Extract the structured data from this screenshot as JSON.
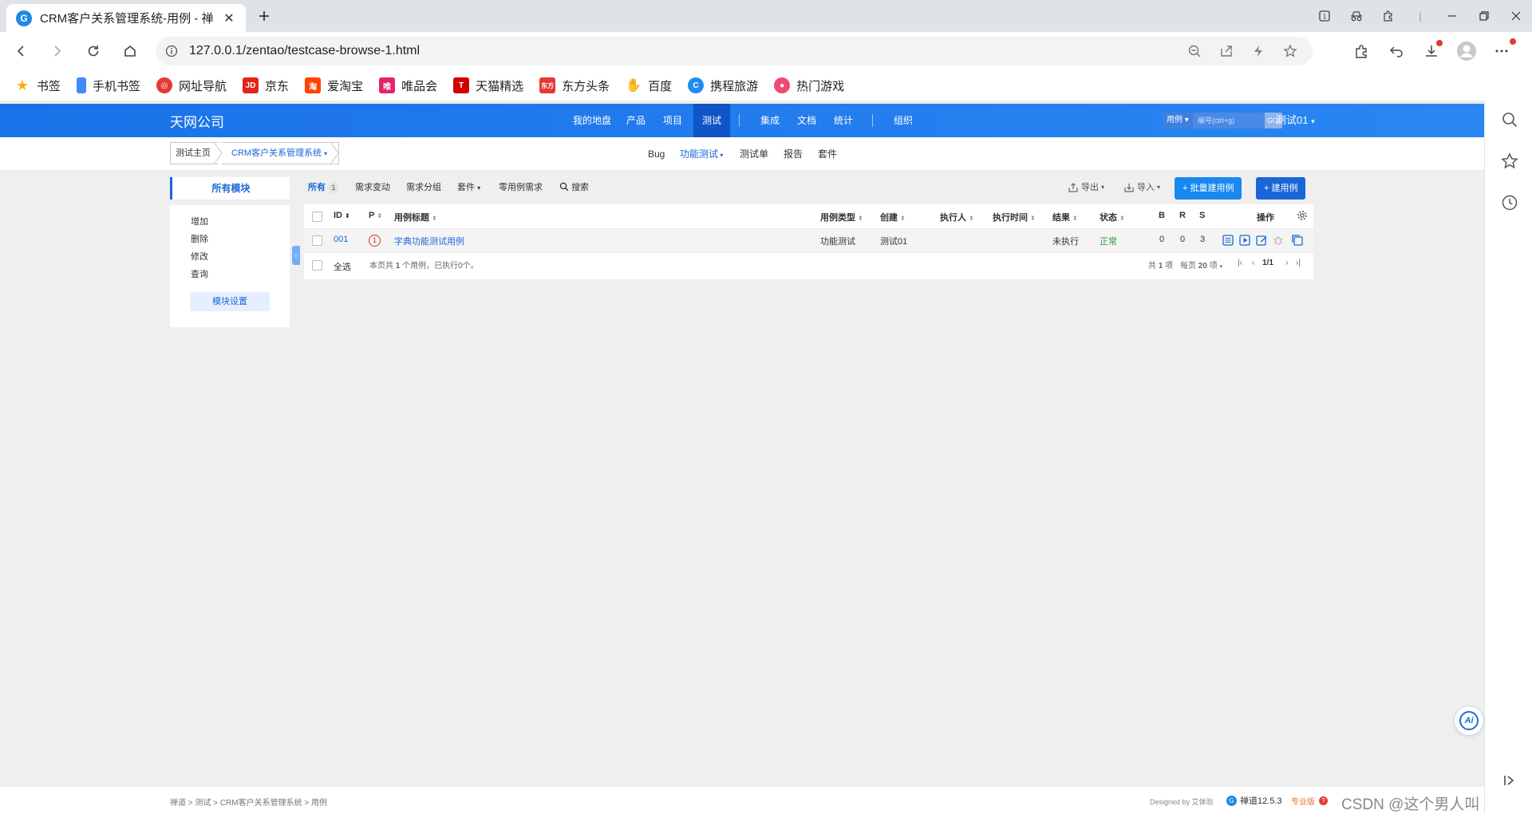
{
  "browser": {
    "tab_title": "CRM客户关系管理系统-用例 - 禅",
    "tab_favicon": "zentao-logo-icon",
    "url": "127.0.0.1/zentao/testcase-browse-1.html",
    "bookmarks": [
      {
        "label": "书签",
        "icon": "star-icon",
        "color": "#f5b400"
      },
      {
        "label": "手机书签",
        "icon": "phone-icon",
        "color": "#3d8bfd"
      },
      {
        "label": "网址导航",
        "icon": "nav-icon",
        "color": "#e53935"
      },
      {
        "label": "京东",
        "icon": "jd-icon",
        "color": "#e1251b"
      },
      {
        "label": "爱淘宝",
        "icon": "taobao-icon",
        "color": "#ff4400"
      },
      {
        "label": "唯品会",
        "icon": "vip-icon",
        "color": "#e5236d"
      },
      {
        "label": "天猫精选",
        "icon": "tmall-icon",
        "color": "#d10000"
      },
      {
        "label": "东方头条",
        "icon": "eastday-icon",
        "color": "#e53935"
      },
      {
        "label": "百度",
        "icon": "baidu-icon",
        "color": "#2932e1"
      },
      {
        "label": "携程旅游",
        "icon": "ctrip-icon",
        "color": "#1f8cf0"
      },
      {
        "label": "热门游戏",
        "icon": "game-icon",
        "color": "#ee4a77"
      }
    ]
  },
  "header": {
    "company": "天网公司",
    "nav": [
      "我的地盘",
      "产品",
      "项目",
      "测试",
      "集成",
      "文档",
      "统计",
      "组织"
    ],
    "active_nav": "测试",
    "search_type": "用例",
    "search_placeholder": "编号(ctrl+g)",
    "search_go": "GO!",
    "user": "测试01"
  },
  "subheader": {
    "crumb_home": "测试主页",
    "crumb_product": "CRM客户关系管理系统",
    "nav": [
      "Bug",
      "功能测试",
      "测试单",
      "报告",
      "套件"
    ],
    "active": "功能测试"
  },
  "modules": {
    "title": "所有模块",
    "items": [
      "增加",
      "删除",
      "修改",
      "查询"
    ],
    "setting": "模块设置"
  },
  "filters": {
    "all": "所有",
    "all_count": "1",
    "req_change": "需求变动",
    "req_group": "需求分组",
    "suite": "套件",
    "zero_case": "零用例需求",
    "search": "搜索"
  },
  "actions": {
    "export": "导出",
    "import": "导入",
    "batch_create": "+ 批量建用例",
    "create": "+ 建用例"
  },
  "table": {
    "headers": {
      "id": "ID",
      "pri": "P",
      "title": "用例标题",
      "type": "用例类型",
      "creator": "创建",
      "executor": "执行人",
      "exec_time": "执行时间",
      "result": "结果",
      "status": "状态",
      "b": "B",
      "r": "R",
      "s": "S",
      "actions": "操作"
    },
    "rows": [
      {
        "id": "001",
        "pri": "1",
        "title": "字典功能测试用例",
        "type": "功能测试",
        "creator": "测试01",
        "executor": "",
        "exec_time": "",
        "result": "未执行",
        "status": "正常",
        "b": "0",
        "r": "0",
        "s": "3"
      }
    ],
    "footer": {
      "select_all": "全选",
      "summary_prefix": "本页共",
      "summary_count": "1",
      "summary_suffix": "个用例，已执行0个。",
      "total_prefix": "共",
      "total_count": "1",
      "total_suffix": "项",
      "per_page_prefix": "每页",
      "per_page": "20",
      "per_page_suffix": "项",
      "page": "1/1"
    }
  },
  "bottom": {
    "breadcrumb": [
      "禅道",
      "测试",
      "CRM客户关系管理系统",
      "用例"
    ],
    "designed_by": "Designed by 艾体验",
    "version": "禅道12.5.3",
    "edition": "专业版",
    "watermark": "CSDN @这个男人叫小帅&"
  }
}
